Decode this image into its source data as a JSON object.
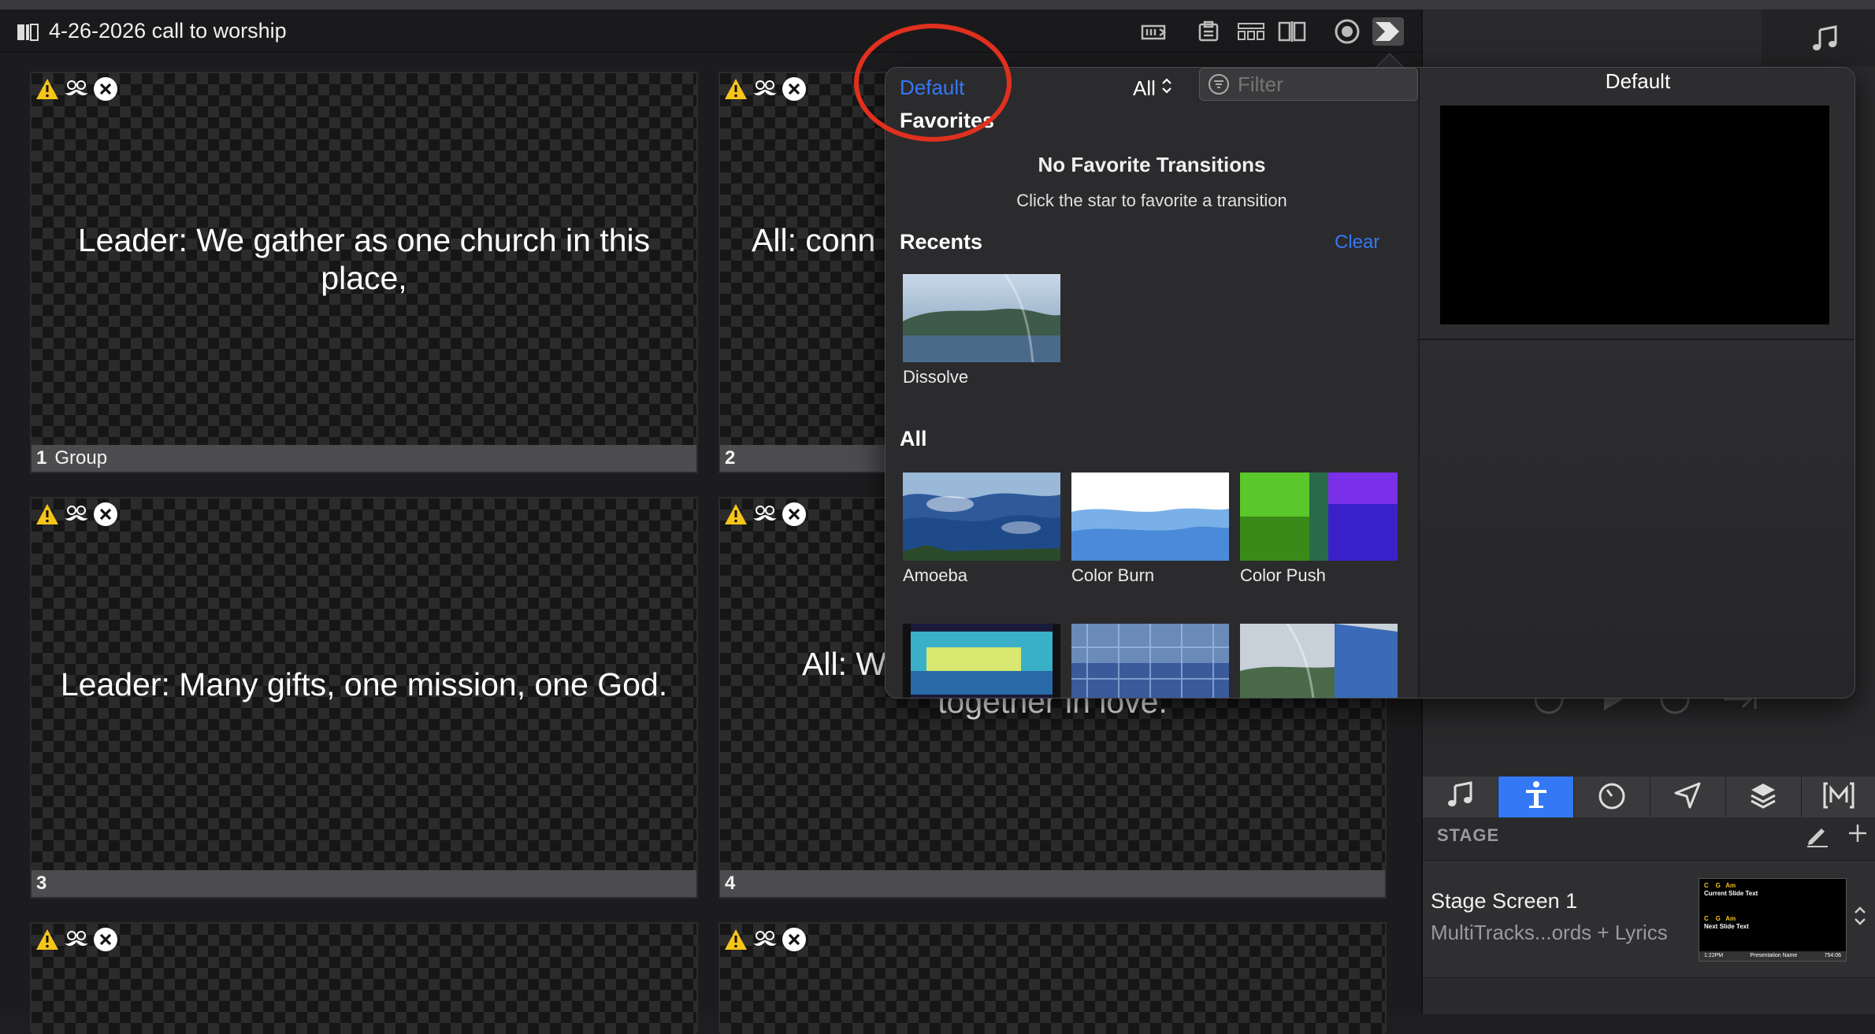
{
  "document": {
    "title": "4-26-2026 call to worship"
  },
  "slides": [
    {
      "number": "1",
      "group": "Group",
      "text": "Leader: We gather as one church in this place,"
    },
    {
      "number": "2",
      "group": "",
      "text": "All: conn"
    },
    {
      "number": "3",
      "group": "",
      "text": "Leader: Many gifts, one mission, one God."
    },
    {
      "number": "4",
      "group": "",
      "text": "All: W",
      "text2": "together in love."
    }
  ],
  "popover": {
    "default_link": "Default",
    "favorites_heading": "Favorites",
    "scope_select": "All",
    "filter_placeholder": "Filter",
    "empty_title": "No Favorite Transitions",
    "empty_subtitle": "Click the star to favorite a transition",
    "recents_heading": "Recents",
    "clear_label": "Clear",
    "recents": [
      {
        "name": "Dissolve"
      }
    ],
    "all_heading": "All",
    "all_transitions": [
      {
        "name": "Amoeba"
      },
      {
        "name": "Color Burn"
      },
      {
        "name": "Color Push"
      }
    ],
    "preview_title": "Default"
  },
  "stage": {
    "section_label": "STAGE",
    "screen_name": "Stage Screen 1",
    "layout_name": "MultiTracks...ords + Lyrics",
    "preview": {
      "chords_top": "C    G   Am",
      "current_label": "Current Slide Text",
      "chords_bottom": "C    G   Am",
      "next_label": "Next Slide Text",
      "clock": "1:22PM",
      "presentation": "Presentation Name",
      "timer": "754:06"
    }
  },
  "colors": {
    "accent": "#3478f6",
    "annotation": "#e0301e",
    "warning": "#f5c518"
  }
}
